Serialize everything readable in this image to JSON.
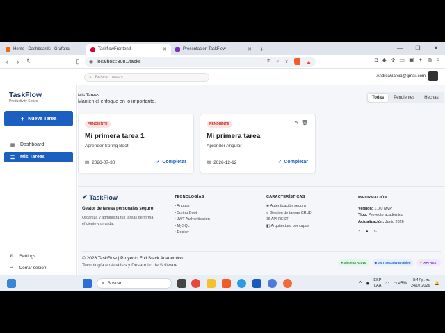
{
  "browser": {
    "tabs": [
      {
        "title": "Home - Dashboards - Grafana",
        "favicon_color": "#f46800"
      },
      {
        "title": "TaskflowFrontend",
        "favicon_color": "#dd0031"
      },
      {
        "title": "Presentación TaskFlow",
        "favicon_color": "#7b2fbe"
      }
    ],
    "url": "localhost:8081/tasks"
  },
  "header": {
    "search_placeholder": "Buscar tareas...",
    "user_email": "AndreaGarcia@gmail.com"
  },
  "sidebar": {
    "brand": "TaskFlow",
    "brand_sub": "Productivity Series",
    "new_task_label": "Nueva Tarea",
    "items": [
      {
        "label": "Dashboard",
        "icon": "dashboard-icon"
      },
      {
        "label": "Mis Tareas",
        "icon": "tasks-icon"
      }
    ],
    "bottom": [
      {
        "label": "Settings",
        "icon": "gear-icon"
      },
      {
        "label": "Cerrar sesión",
        "icon": "logout-icon"
      }
    ]
  },
  "main": {
    "title": "Mis Tareas",
    "subtitle": "Mantén el enfoque en lo importante.",
    "filters": [
      "Todas",
      "Pendientes",
      "Hechas"
    ],
    "active_filter": "Todas",
    "tasks": [
      {
        "status": "PENDIENTE",
        "title": "Mi primera tarea 1",
        "description": "Aprender Spring Boot",
        "date": "2026-07-30",
        "action": "Completar"
      },
      {
        "status": "PENDIENTE",
        "title": "Mi primera tarea",
        "description": "Aprender Angular",
        "date": "2026-12-12",
        "action": "Completar"
      }
    ]
  },
  "footer": {
    "brand": "TaskFlow",
    "tagline": "Gestor de tareas personales seguro",
    "description": "Organiza y administra tus tareas de forma eficiente y privada.",
    "tech_heading": "TECNOLOGÍAS",
    "tech": [
      "Angular",
      "Spring Boot",
      "JWT Authentication",
      "MySQL",
      "Docker"
    ],
    "features_heading": "CARACTERÍSTICAS",
    "features": [
      "Autenticación segura",
      "Gestión de tareas CRUD",
      "API REST",
      "Arquitectura por capas"
    ],
    "info_heading": "INFORMACIÓN",
    "info": [
      {
        "label": "Versión:",
        "value": "1.0.0 MVP"
      },
      {
        "label": "Tipo:",
        "value": "Proyecto académico"
      },
      {
        "label": "Actualización:",
        "value": "Junio 2026"
      }
    ],
    "copyright": "© 2026 TaskFlow | Proyecto Full Stack Académico",
    "program": "Tecnología en Análisis y Desarrollo de Software",
    "badges": [
      "Sistema Activo",
      "JWT Security Enabled",
      "API REST"
    ]
  },
  "taskbar": {
    "search_placeholder": "Buscar",
    "lang": "ESP",
    "lang2": "LAA",
    "battery": "45%",
    "time": "8:47 p. m.",
    "date": "24/07/2026"
  }
}
